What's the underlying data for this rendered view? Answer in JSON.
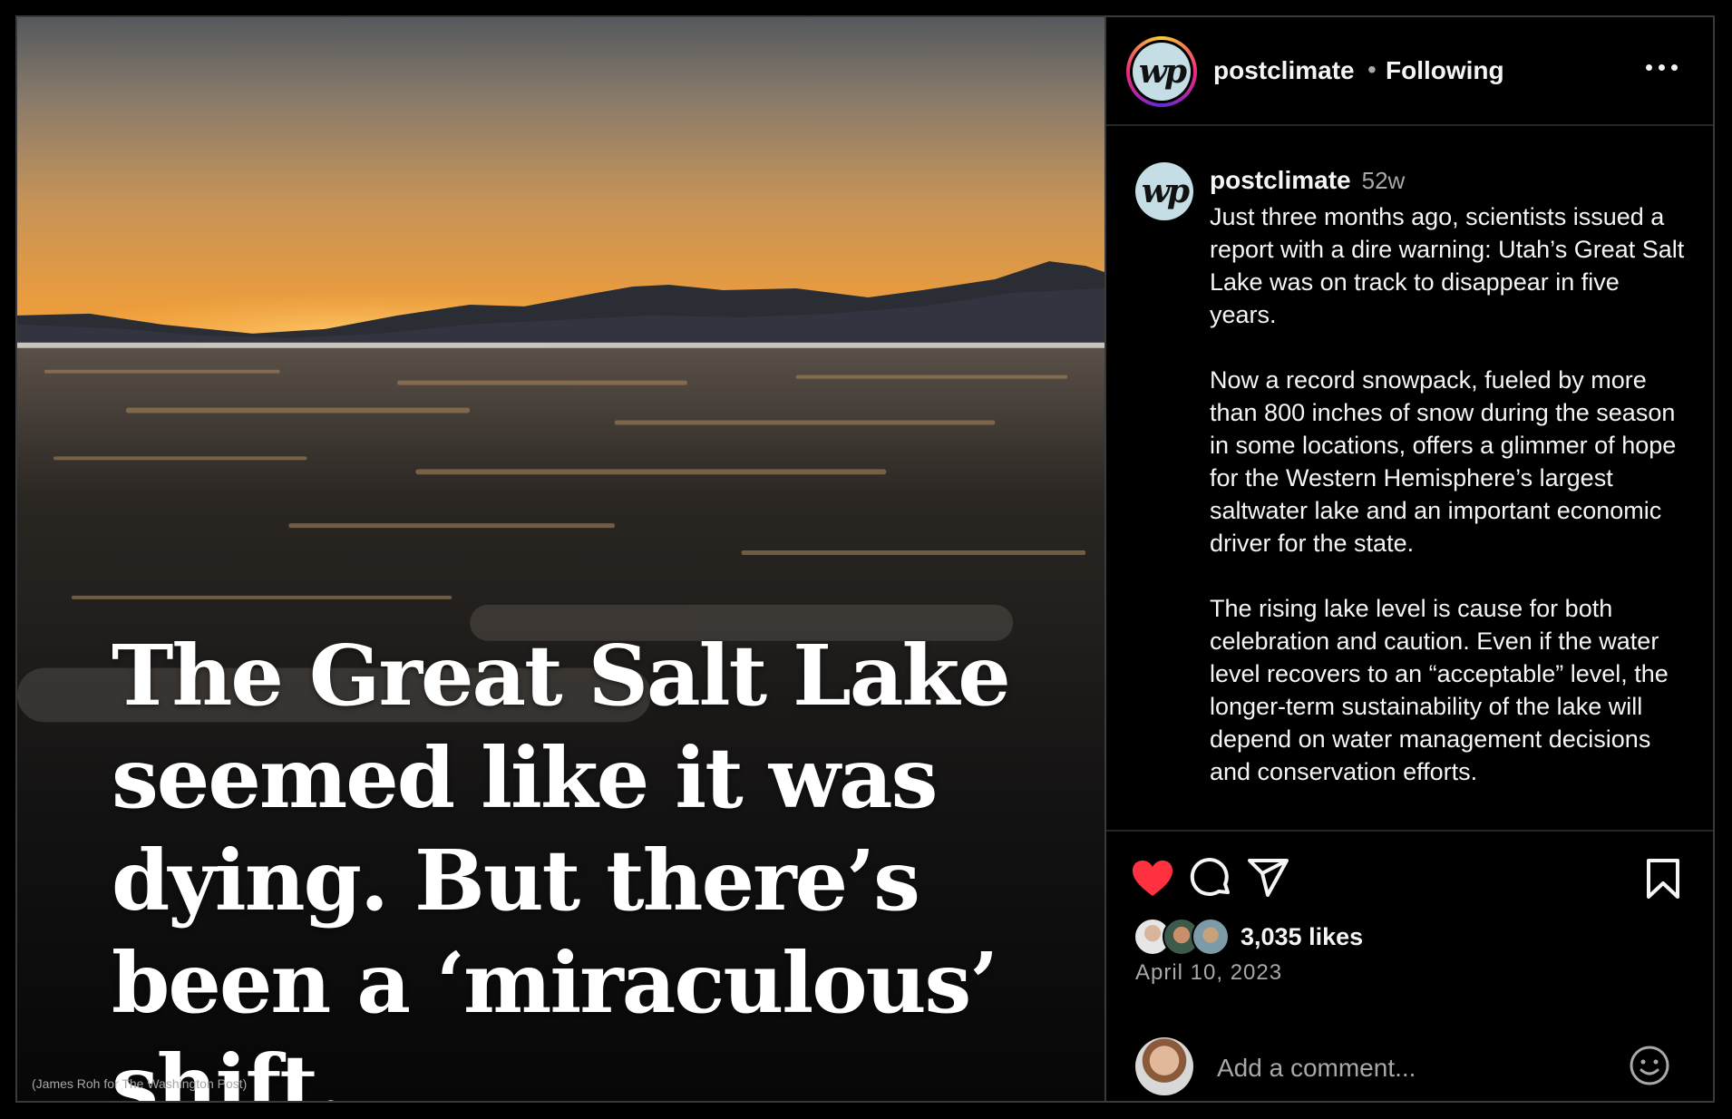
{
  "post": {
    "username": "postclimate",
    "follow_status": "Following",
    "separator": "•",
    "avatar_text": "wp"
  },
  "image": {
    "headline": "The Great Salt Lake seemed like it was dying. But there’s been a ‘miraculous’ shift.",
    "credit": "(James Roh for The Washington Post)"
  },
  "caption": {
    "username": "postclimate",
    "time_ago": "52w",
    "paragraphs": [
      "Just three months ago, scientists issued a report with a dire warning: Utah’s Great Salt Lake was on track to disappear in five years.",
      "Now a record snowpack, fueled by more than 800 inches of snow during the season in some locations, offers a glimmer of hope for the Western Hemisphere’s largest saltwater lake and an important economic driver for the state.",
      "The rising lake level is cause for both celebration and caution. Even if the water level recovers to an “acceptable” level, the longer-term sustainability of the lake will depend on water management decisions and conservation efforts."
    ]
  },
  "engagement": {
    "likes": "3,035 likes",
    "date": "April 10, 2023",
    "liked": true,
    "like_color": "#ff3040"
  },
  "comment": {
    "placeholder": "Add a comment..."
  },
  "icons": [
    "more-icon",
    "heart-icon",
    "comment-icon",
    "share-icon",
    "bookmark-icon",
    "emoji-icon"
  ]
}
